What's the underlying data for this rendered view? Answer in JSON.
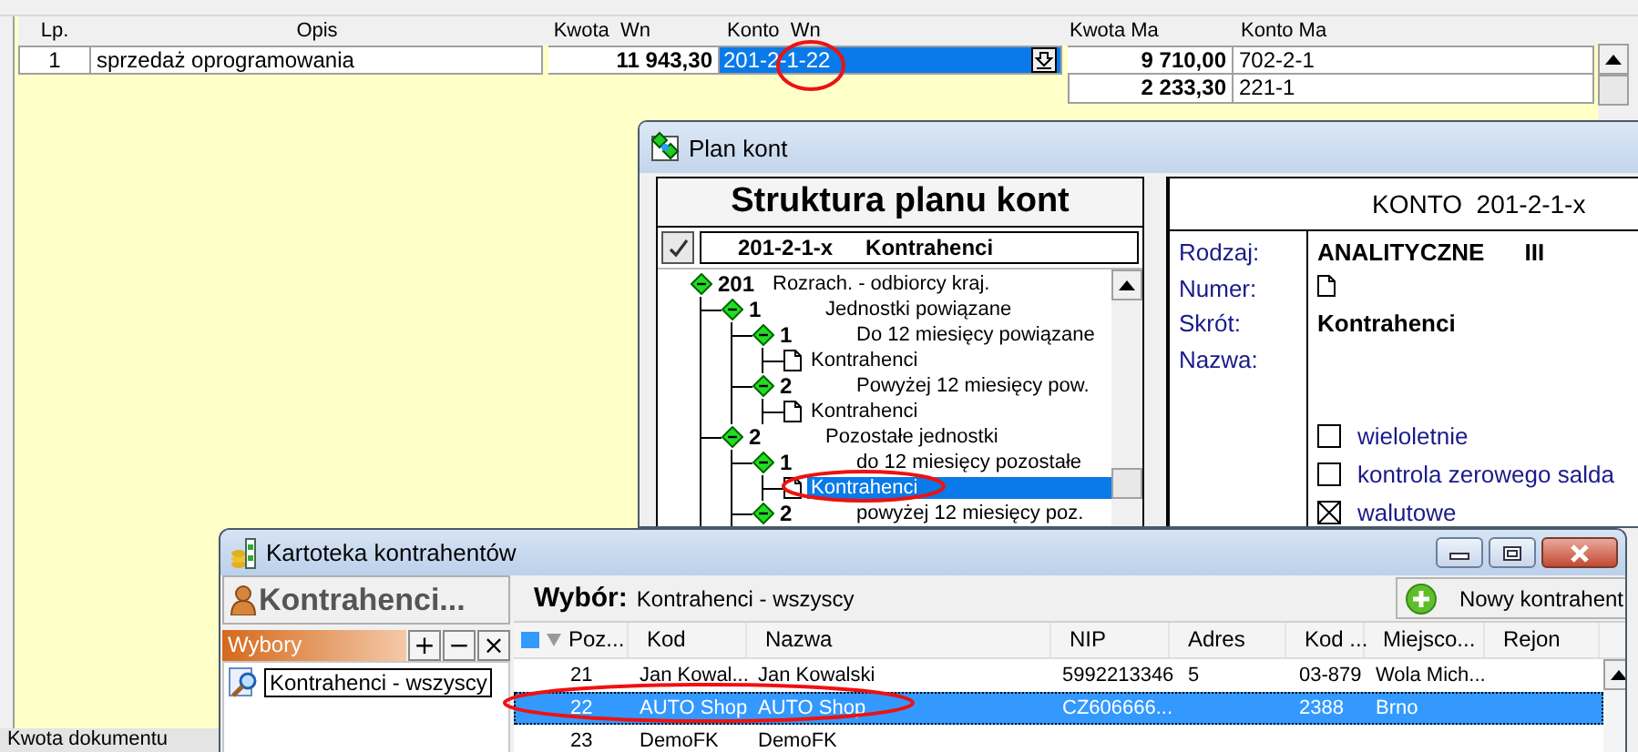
{
  "main": {
    "columns": [
      "Lp.",
      "Opis",
      "Kwota  Wn",
      "Konto  Wn",
      "Kwota Ma",
      "Konto Ma"
    ],
    "entries": [
      {
        "lp": "1",
        "opis": "sprzedaż oprogramowania",
        "kwota_wn": "11 943,30",
        "konto_wn": "201-2-1-22",
        "editing": true,
        "kwota_ma": "9 710,00",
        "konto_ma": "702-2-1"
      },
      {
        "kwota_ma": "2 233,30",
        "konto_ma": "221-1"
      }
    ],
    "footer_label": "Kwota dokumentu"
  },
  "plan_kont": {
    "title": "Plan kont",
    "heading": "Struktura planu kont",
    "selector": {
      "code": "201-2-1-x",
      "name": "Kontrahenci"
    },
    "tree": [
      {
        "kind": "group",
        "number": "201",
        "name": "Rozrach. - odbiorcy kraj.",
        "selected": false,
        "children": [
          {
            "kind": "group",
            "number": "1",
            "name": "Jednostki powiązane",
            "selected": false,
            "children": [
              {
                "kind": "group",
                "number": "1",
                "name": "Do 12 miesięcy powiązane",
                "selected": false,
                "children": [
                  {
                    "kind": "leaf",
                    "name": "Kontrahenci",
                    "selected": false
                  }
                ]
              },
              {
                "kind": "group",
                "number": "2",
                "name": "Powyżej 12 miesięcy pow.",
                "selected": false,
                "children": [
                  {
                    "kind": "leaf",
                    "name": "Kontrahenci",
                    "selected": false
                  }
                ]
              }
            ]
          },
          {
            "kind": "group",
            "number": "2",
            "name": "Pozostałe jednostki",
            "selected": false,
            "children": [
              {
                "kind": "group",
                "number": "1",
                "name": "do 12 miesięcy pozostałe",
                "selected": false,
                "children": [
                  {
                    "kind": "leaf",
                    "name": "Kontrahenci",
                    "selected": true
                  }
                ]
              },
              {
                "kind": "group",
                "number": "2",
                "name": "powyżej 12 miesięcy poz.",
                "selected": false
              }
            ]
          }
        ]
      }
    ],
    "detail": {
      "heading": "KONTO  201-2-1-x",
      "fields": [
        {
          "label": "Rodzaj:",
          "kind": "text",
          "value": "ANALITYCZNE",
          "grade": "III"
        },
        {
          "label": "Numer:",
          "kind": "icon"
        },
        {
          "label": "Skrót:",
          "kind": "text",
          "value": "Kontrahenci"
        },
        {
          "label": "Nazwa:",
          "kind": "empty"
        }
      ],
      "options": [
        {
          "label": "wieloletnie",
          "checked": false
        },
        {
          "label": "kontrola zerowego salda",
          "checked": false
        },
        {
          "label": "walutowe",
          "checked": true
        }
      ]
    }
  },
  "kartoteka": {
    "title": "Kartoteka kontrahentów",
    "panel_title": "Kontrahenci...",
    "filters_label": "Wybory",
    "filter_buttons": [
      "+",
      "−",
      "×"
    ],
    "filters": [
      {
        "label": "Kontrahenci - wszyscy",
        "selected": true
      }
    ],
    "selection_label": "Wybór:",
    "selection": "Kontrahenci - wszyscy",
    "new_button": "Nowy kontrahent",
    "columns": [
      "Poz...",
      "Kod",
      "Nazwa",
      "NIP",
      "Adres",
      "Kod ...",
      "Miejsco...",
      "Rejon"
    ],
    "rows": [
      {
        "poz": "21",
        "kod": "Jan Kowal...",
        "nazwa": "Jan Kowalski",
        "nip": "5992213346",
        "adres": "5",
        "kod_2": "03-879",
        "miejsco": "Wola Mich...",
        "selected": false
      },
      {
        "poz": "22",
        "kod": "AUTO Shop",
        "nazwa": "AUTO Shop",
        "nip": "CZ606666...",
        "kod_2": "2388",
        "miejsco": "Brno",
        "selected": true
      },
      {
        "poz": "23",
        "kod": "DemoFK",
        "nazwa": "DemoFK",
        "selected": false
      }
    ]
  }
}
